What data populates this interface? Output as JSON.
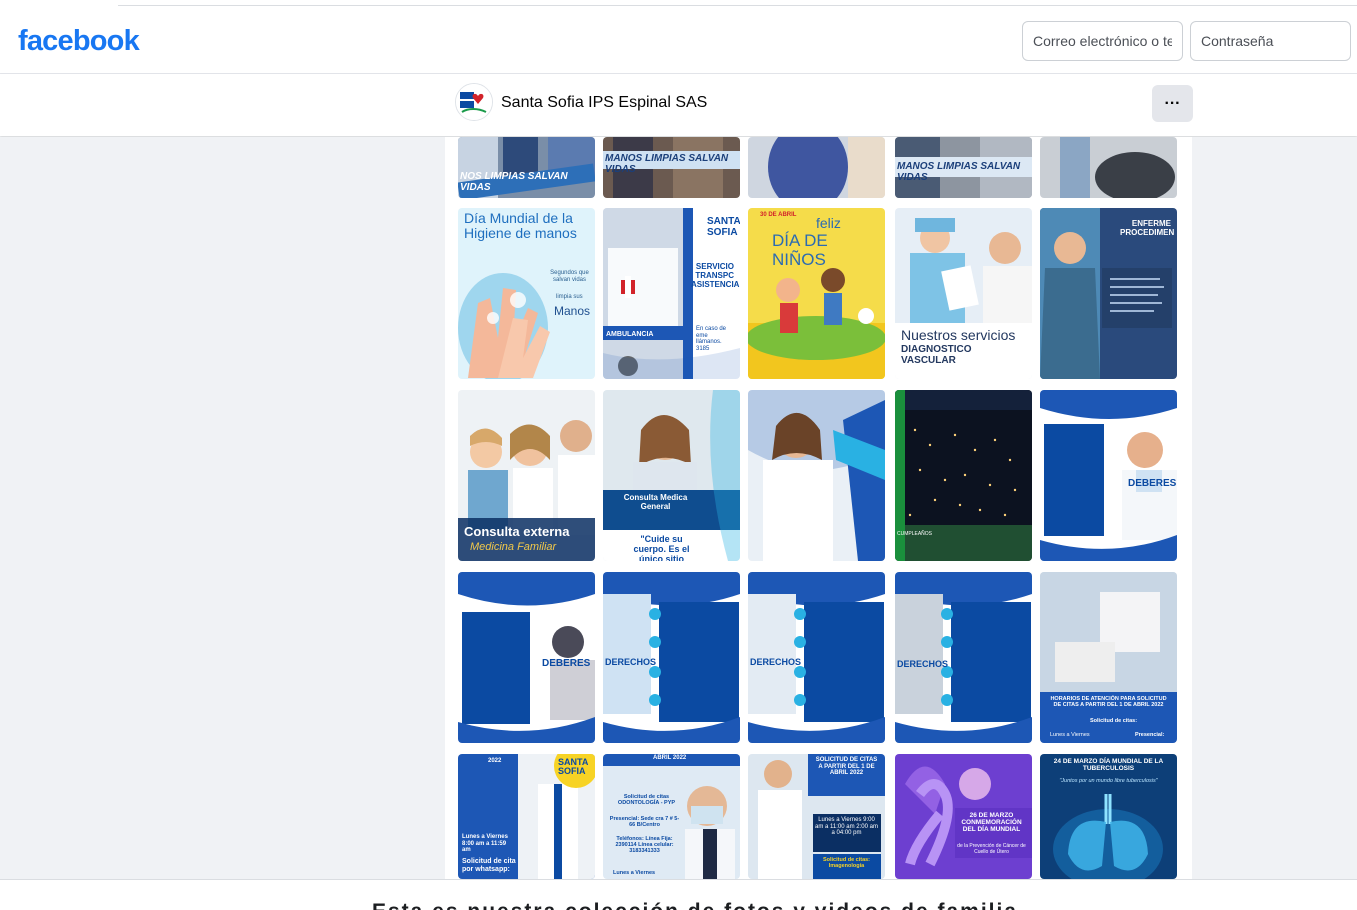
{
  "header": {
    "logo": "facebook",
    "email_placeholder": "Correo electrónico o tel",
    "password_placeholder": "Contraseña"
  },
  "page": {
    "name": "Santa Sofia IPS Espinal SAS",
    "more_label": "···"
  },
  "tiles": {
    "r0c0": "NOS LIMPIAS SALVAN VIDAS",
    "r0c1": "MANOS LIMPIAS SALVAN VIDAS",
    "r0c3": "MANOS LIMPIAS SALVAN VIDAS",
    "r1c0_title": "Día Mundial de la Higiene de manos",
    "r1c0_sub": "Segundos que salvan vidas",
    "r1c0_limpia": "limpia sus",
    "r1c0_manos": "Manos",
    "r1c1_service": "SERVICIO TRANSPC ASISTENCIAL",
    "r1c1_amb": "AMBULANCIA",
    "r1c1_call": "En caso de eme llámanos. 3185",
    "r1c2_feliz": "feliz",
    "r1c2_dia": "DÍA DE NIÑOS",
    "r1c2_date": "30 DE ABRIL",
    "r1c3_title": "Nuestros servicios",
    "r1c3_sub": "DIAGNOSTICO VASCULAR",
    "r1c4_title": "ENFERME PROCEDIMEN",
    "r2c0_title": "Consulta externa",
    "r2c0_sub": "Medicina Familiar",
    "r2c1_title": "Consulta Medica General",
    "r2c1_quote": "\"Cuide su cuerpo. Es el único sitio",
    "r2c3_a": "CUMPLEAÑOS",
    "r2c4_title": "DEBERES",
    "r3c0_title": "DEBERES",
    "r3c1_title": "DERECHOS",
    "r3c2_title": "DERECHOS",
    "r3c3_title": "DERECHOS",
    "r3c4_title": "HORARIOS DE ATENCIÓN PARA SOLICITUD DE CITAS A PARTIR DEL 1 DE ABRIL 2022",
    "r3c4_sub": "Solicitud de citas:",
    "r3c4_days": "Lunes a Viernes",
    "r3c4_pres": "Presencial:",
    "r4c0_days": "Lunes a Viernes 8:00 am a 11:59 am",
    "r4c0_sol": "Solicitud de cita por whatsapp:",
    "r4c0_year": "2022",
    "r4c1_head": "ABRIL 2022",
    "r4c1_sol": "Solicitud de citas ODONTOLOGÍA - PYP",
    "r4c1_pres": "Presencial: Sede cra 7 # 5-66 B/Centro",
    "r4c1_tel": "Teléfonos: Línea Fija: 2390114 Línea celular: 3183341333",
    "r4c1_days": "Lunes a Viernes",
    "r4c2_title": "SOLICITUD DE CITAS A PARTIR DEL 1 DE ABRIL 2022",
    "r4c2_days": "Lunes a Viernes 9:00 am a 11:00 am 2:00 am a 04:00 pm",
    "r4c2_sol": "Solicitud de citas: Imagenología",
    "r4c3_title": "26 DE MARZO CONMEMORACIÓN DEL DÍA MUNDIAL",
    "r4c3_sub": "de la Prevención de Cáncer de Cuello de Útero",
    "r4c4_title": "24 DE MARZO DÍA MUNDIAL DE LA TUBERCULOSIS",
    "r4c4_sub": "\"Juntos por un mundo libre tuberculosis\""
  },
  "footer": {
    "text": "Esta es nuestra colección de fotos y videos de familia."
  },
  "colors": {
    "brand": "#1877f2",
    "page_bg": "#f0f2f5",
    "sofia_blue": "#0b4aa2",
    "sofia_red": "#d2232a"
  }
}
